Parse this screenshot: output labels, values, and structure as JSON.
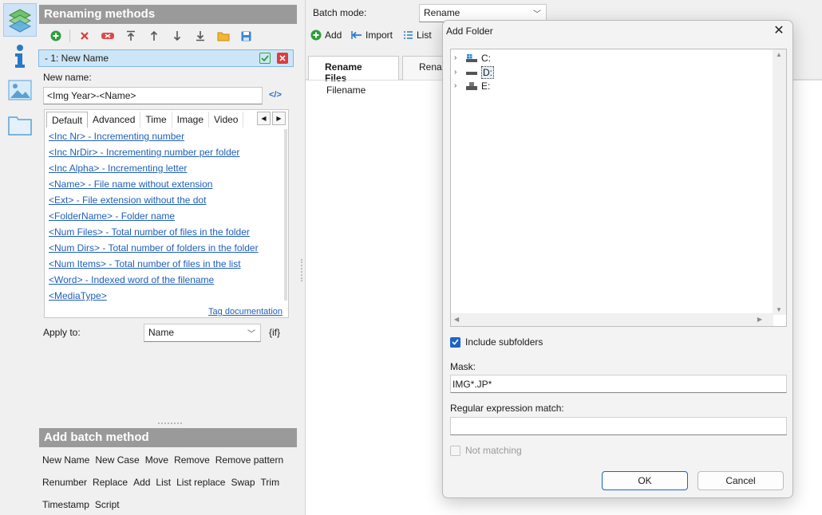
{
  "rail": {
    "items": [
      "renaming-methods",
      "information",
      "image-preview",
      "folder-browser"
    ]
  },
  "methods": {
    "title": "Renaming methods",
    "current": "-  1: New Name",
    "new_name_label": "New name:",
    "new_name_value": "<Img Year>-<Name>",
    "tag_button": "</>",
    "tabs": [
      "Default",
      "Advanced",
      "Time",
      "Image",
      "Video"
    ],
    "tags": [
      "<Inc Nr>  - Incrementing number",
      "<Inc NrDir>  - Incrementing number per folder",
      "<Inc Alpha>  - Incrementing letter",
      "<Name>  - File name without extension",
      "<Ext>  - File extension without the dot",
      "<FolderName>  - Folder name",
      "<Num Files>  - Total number of files in the folder",
      "<Num Dirs>  - Total number of folders in the folder",
      "<Num Items>  - Total number of files in the list",
      "<Word>  - Indexed word of the filename",
      "<MediaType>"
    ],
    "tag_documentation": "Tag documentation",
    "apply_to_label": "Apply to:",
    "apply_to_value": "Name",
    "if_label": "{if}"
  },
  "batch": {
    "title": "Add batch method",
    "methods": [
      "New Name",
      "New Case",
      "Move",
      "Remove",
      "Remove pattern",
      "Renumber",
      "Replace",
      "Add",
      "List",
      "List replace",
      "Swap",
      "Trim",
      "Timestamp",
      "Script"
    ]
  },
  "main": {
    "batch_mode_label": "Batch mode:",
    "batch_mode_value": "Rename",
    "toolbar": {
      "add": "Add",
      "import": "Import",
      "list": "List"
    },
    "tabs": [
      "Rename Files",
      "Renam"
    ],
    "column_filename": "Filename"
  },
  "dialog": {
    "title": "Add Folder",
    "close": "✕",
    "drives": [
      "C:",
      "D:",
      "E:"
    ],
    "include_subfolders": "Include subfolders",
    "include_subfolders_checked": true,
    "mask_label": "Mask:",
    "mask_value": "IMG*.JP*",
    "regex_label": "Regular expression match:",
    "regex_value": "",
    "not_matching": "Not matching",
    "not_matching_checked": false,
    "ok": "OK",
    "cancel": "Cancel"
  },
  "colors": {
    "accent": "#1a64c9",
    "section_header": "#9a9a9a",
    "selection": "#cde6f7",
    "link": "#1f5fb8"
  }
}
